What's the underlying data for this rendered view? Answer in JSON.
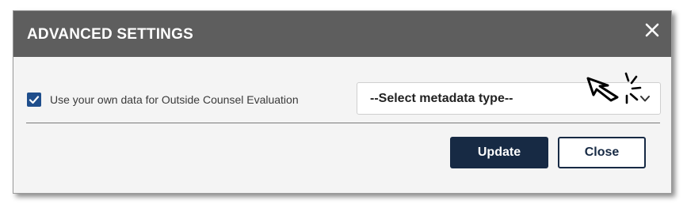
{
  "dialog": {
    "title": "ADVANCED SETTINGS",
    "close_icon": "close-icon"
  },
  "options": {
    "use_own_data": {
      "checked": true,
      "label": "Use your own data for Outside Counsel Evaluation"
    },
    "metadata_select": {
      "selected": "--Select metadata type--",
      "icon": "chevron-down-icon"
    }
  },
  "footer": {
    "update_label": "Update",
    "close_label": "Close"
  },
  "colors": {
    "header_bg": "#5e5e5e",
    "primary": "#172a44",
    "checkbox": "#1f4e8c",
    "body_bg": "#f4f4f4"
  }
}
